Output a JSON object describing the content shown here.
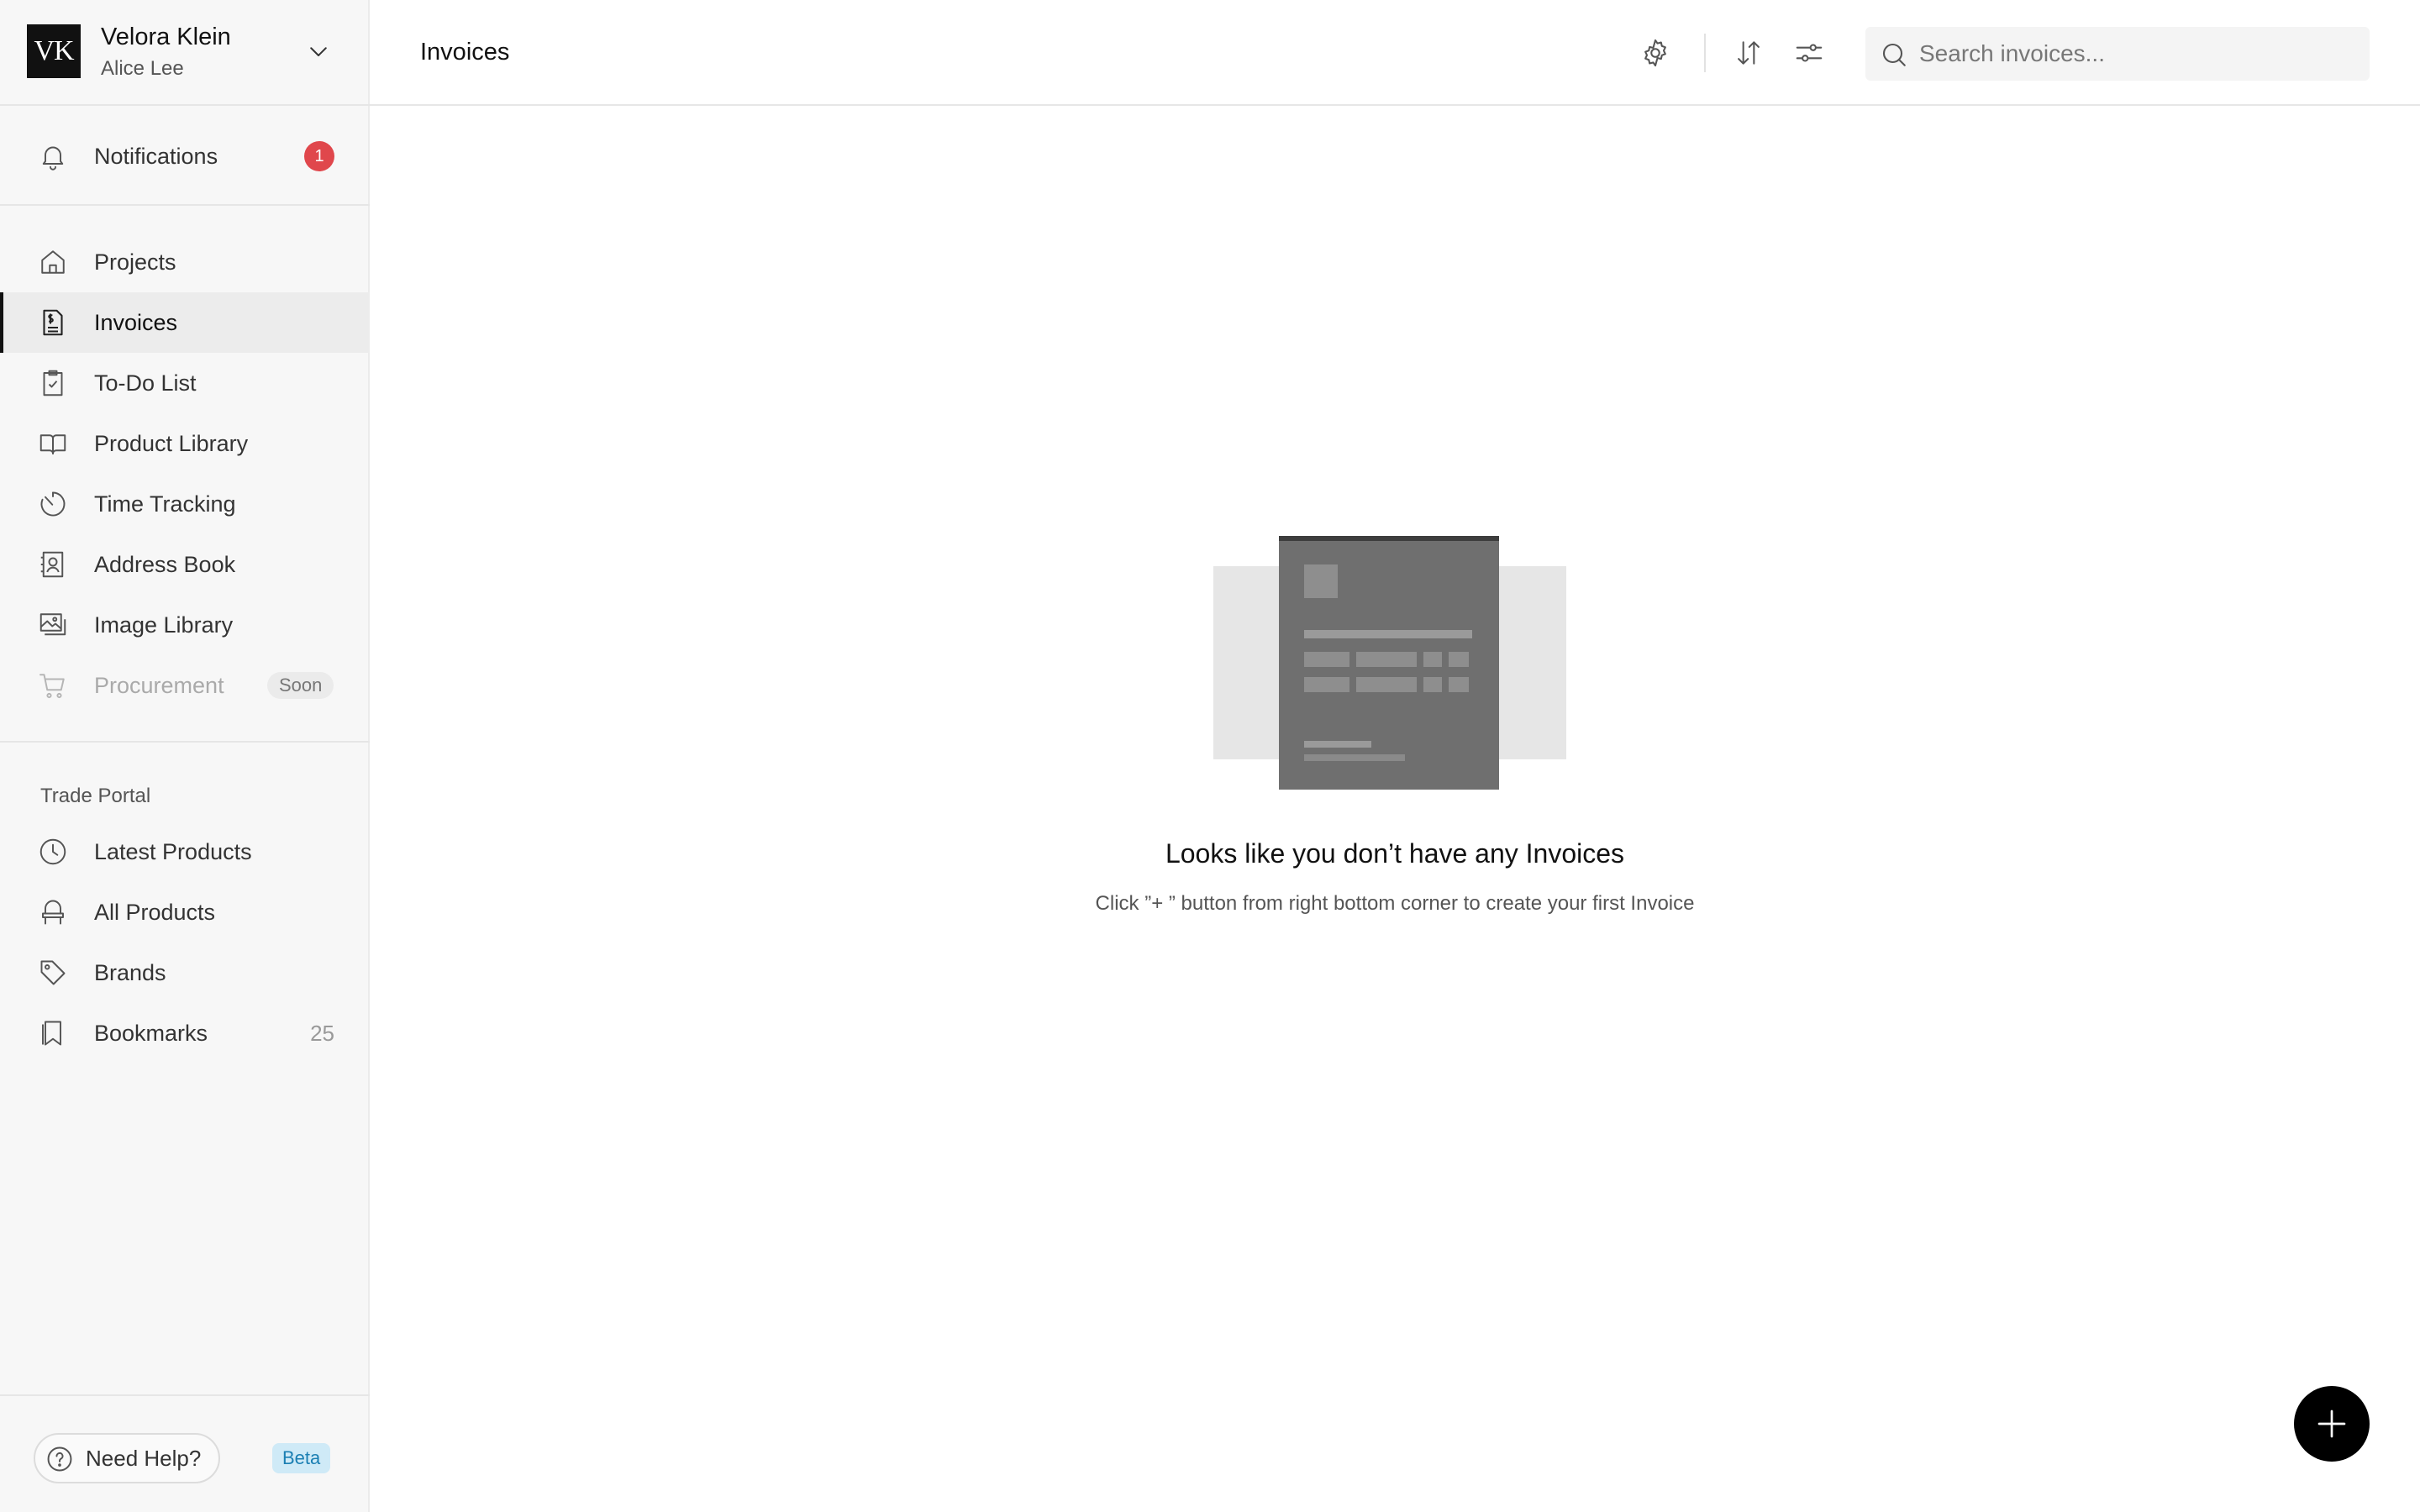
{
  "workspace": {
    "logo_text": "VK",
    "name": "Velora Klein",
    "user": "Alice Lee"
  },
  "notifications": {
    "label": "Notifications",
    "count": "1"
  },
  "nav": {
    "items": [
      {
        "label": "Projects",
        "icon": "home-icon"
      },
      {
        "label": "Invoices",
        "icon": "invoice-icon",
        "active": true
      },
      {
        "label": "To-Do List",
        "icon": "clipboard-check-icon"
      },
      {
        "label": "Product Library",
        "icon": "book-icon"
      },
      {
        "label": "Time Tracking",
        "icon": "timer-icon"
      },
      {
        "label": "Address Book",
        "icon": "contact-book-icon"
      },
      {
        "label": "Image Library",
        "icon": "images-icon"
      },
      {
        "label": "Procurement",
        "icon": "cart-icon",
        "disabled": true,
        "badge": "Soon"
      }
    ]
  },
  "trade_portal": {
    "title": "Trade Portal",
    "items": [
      {
        "label": "Latest Products",
        "icon": "clock-icon"
      },
      {
        "label": "All Products",
        "icon": "chair-icon"
      },
      {
        "label": "Brands",
        "icon": "tag-icon"
      },
      {
        "label": "Bookmarks",
        "icon": "bookmark-icon",
        "count": "25"
      }
    ]
  },
  "footer": {
    "help_label": "Need Help?",
    "beta_label": "Beta"
  },
  "header": {
    "title": "Invoices",
    "search_placeholder": "Search invoices..."
  },
  "empty_state": {
    "title": "Looks like you don’t have any Invoices",
    "subtitle": "Click ”+ ” button from right bottom corner to create your first Invoice"
  },
  "colors": {
    "accent": "#111111",
    "notification_badge": "#e0474c",
    "beta_bg": "#cfeaf7",
    "beta_text": "#1b7fb3",
    "sidebar_bg": "#f7f7f7"
  }
}
